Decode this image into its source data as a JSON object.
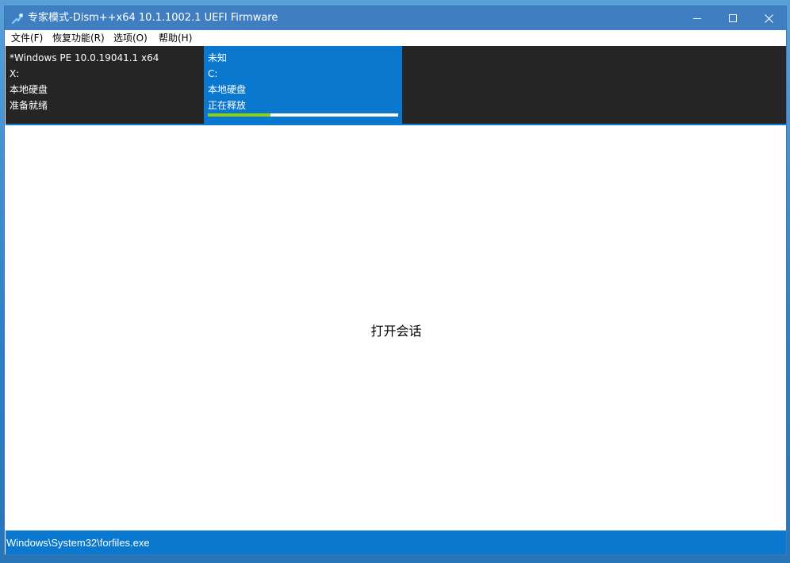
{
  "window": {
    "title": "专家模式-Dism++x64 10.1.1002.1 UEFI Firmware",
    "app_icon": "dism-icon"
  },
  "menu": [
    {
      "label": "文件(F)"
    },
    {
      "label": "恢复功能(R)"
    },
    {
      "label": "选项(O)"
    },
    {
      "label": "帮助(H)"
    }
  ],
  "sessions": [
    {
      "name": "*Windows PE 10.0.19041.1 x64",
      "drive": "X:",
      "disk_type": "本地硬盘",
      "status": "准备就绪",
      "selected": false
    },
    {
      "name": "未知",
      "drive": "C:",
      "disk_type": "本地硬盘",
      "status": "正在释放",
      "progress": 0.33,
      "selected": true
    }
  ],
  "content": {
    "open_session": "打开会话"
  },
  "statusbar": {
    "text": "Windows\\System32\\forfiles.exe"
  },
  "colors": {
    "titlebar": "#3f7fc1",
    "accent": "#0b78cf",
    "session_bg": "#252526",
    "progress_fill": "#8ed00f"
  }
}
